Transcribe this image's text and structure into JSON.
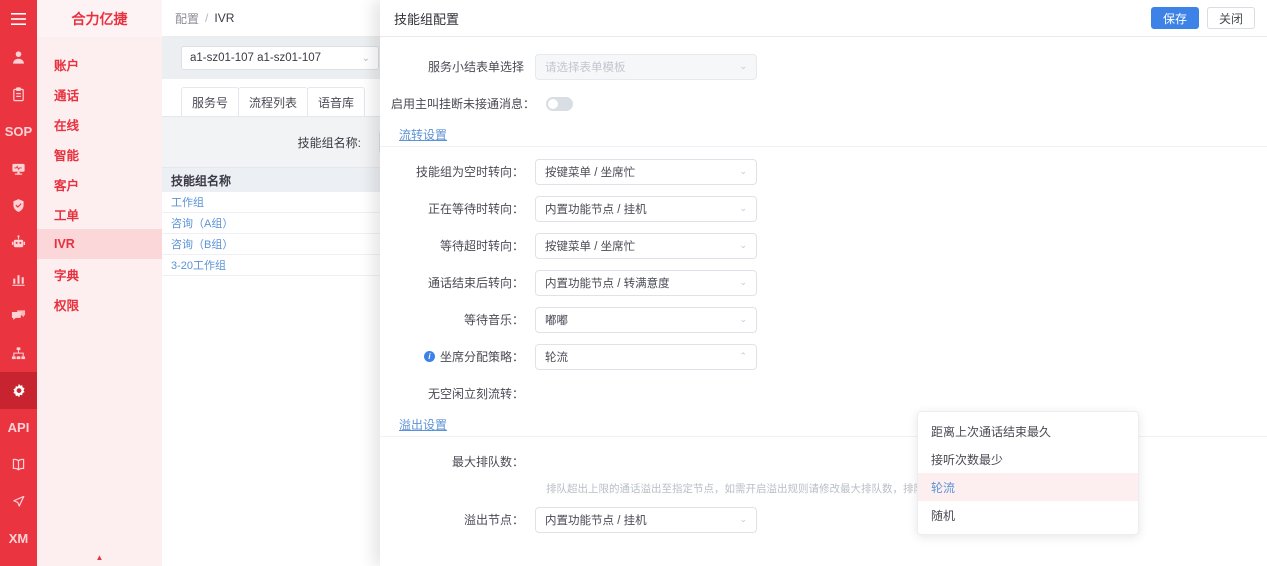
{
  "rail": {
    "burger_icon": "hamburger-menu-icon",
    "items": [
      {
        "name": "user-icon",
        "glyph": "person",
        "label": "",
        "active": false
      },
      {
        "name": "clipboard-icon",
        "glyph": "clipboard",
        "label": "",
        "active": false
      },
      {
        "name": "sop-icon",
        "glyph": "text",
        "label": "SOP",
        "active": false
      },
      {
        "name": "monitor-icon",
        "glyph": "monitor",
        "label": "",
        "active": false
      },
      {
        "name": "shield-icon",
        "glyph": "shield",
        "label": "",
        "active": false
      },
      {
        "name": "robot-icon",
        "glyph": "robot",
        "label": "",
        "active": false
      },
      {
        "name": "chart-icon",
        "glyph": "chart",
        "label": "",
        "active": false
      },
      {
        "name": "chat-icon",
        "glyph": "chat",
        "label": "",
        "active": false
      },
      {
        "name": "org-tree-icon",
        "glyph": "tree",
        "label": "",
        "active": false
      },
      {
        "name": "gear-icon",
        "glyph": "gear",
        "label": "",
        "active": true
      },
      {
        "name": "api-icon",
        "glyph": "text",
        "label": "API",
        "active": false
      },
      {
        "name": "book-icon",
        "glyph": "book",
        "label": "",
        "active": false
      },
      {
        "name": "megaphone-icon",
        "glyph": "megaphone",
        "label": "",
        "active": false
      },
      {
        "name": "xm-icon",
        "glyph": "text",
        "label": "XM",
        "active": false
      }
    ]
  },
  "nav": {
    "brand": "合力亿捷",
    "collapse_glyph": "▲",
    "items": [
      {
        "label": "账户",
        "active": false
      },
      {
        "label": "通话",
        "active": false
      },
      {
        "label": "在线",
        "active": false
      },
      {
        "label": "智能",
        "active": false
      },
      {
        "label": "客户",
        "active": false
      },
      {
        "label": "工单",
        "active": false
      },
      {
        "label": "IVR",
        "active": true
      },
      {
        "label": "字典",
        "active": false
      },
      {
        "label": "权限",
        "active": false
      }
    ]
  },
  "page": {
    "breadcrumb": {
      "root": "配置",
      "sep": "/",
      "current": "IVR"
    },
    "account_select": {
      "value": "a1-sz01-107 a1-sz01-107",
      "caret": "⌄"
    },
    "tabs": [
      {
        "label": "服务号",
        "active": false
      },
      {
        "label": "流程列表",
        "active": false
      },
      {
        "label": "语音库",
        "active": false
      }
    ],
    "filter": {
      "label": "技能组名称:",
      "value": "",
      "placeholder": ""
    },
    "table": {
      "header": "技能组名称",
      "rows": [
        "工作组",
        "咨询（A组）",
        "咨询（B组）",
        "3-20工作组"
      ]
    }
  },
  "modal": {
    "title": "技能组配置",
    "save_label": "保存",
    "close_label": "关闭",
    "fields": {
      "summary_form": {
        "label": "服务小结表单选择",
        "value": "",
        "placeholder": "请选择表单模板",
        "disabled": true,
        "caret": "⌄"
      },
      "caller_hangup_msg": {
        "label": "启用主叫挂断未接通消息：",
        "on": false
      }
    },
    "flow_section": {
      "title": "流转设置"
    },
    "flow_fields": [
      {
        "label": "技能组为空时转向：",
        "value": "按键菜单 / 坐席忙",
        "caret": "⌄"
      },
      {
        "label": "正在等待时转向：",
        "value": "内置功能节点 / 挂机",
        "caret": "⌄"
      },
      {
        "label": "等待超时转向：",
        "value": "按键菜单 / 坐席忙",
        "caret": "⌄"
      },
      {
        "label": "通话结束后转向：",
        "value": "内置功能节点 / 转满意度",
        "caret": "⌄"
      },
      {
        "label": "等待音乐：",
        "value": "嘟嘟",
        "caret": "⌄"
      }
    ],
    "strategy_field": {
      "label": "坐席分配策略：",
      "info_icon": "info-icon",
      "value": "轮流",
      "caret": "⌃",
      "open": true,
      "options": [
        "距离上次通话结束最久",
        "接听次数最少",
        "轮流",
        "随机"
      ],
      "selected": "轮流"
    },
    "idle_field": {
      "label": "无空闲立刻流转：",
      "value": ""
    },
    "overflow_section": {
      "title": "溢出设置"
    },
    "overflow_fields": [
      {
        "label": "最大排队数：",
        "value": ""
      },
      {
        "label": "溢出节点：",
        "value": "内置功能节点 / 挂机",
        "caret": "⌄"
      }
    ],
    "overflow_hint": "排队超出上限的通话溢出至指定节点，如需开启溢出规则请修改最大排队数，排队数配置为0时不溢出。"
  },
  "colors": {
    "brand_red": "#ea3440",
    "nav_bg": "#fdeeef",
    "primary_blue": "#3d82e6",
    "link_blue": "#5b93d6",
    "selected_bg": "#fdeeef"
  }
}
